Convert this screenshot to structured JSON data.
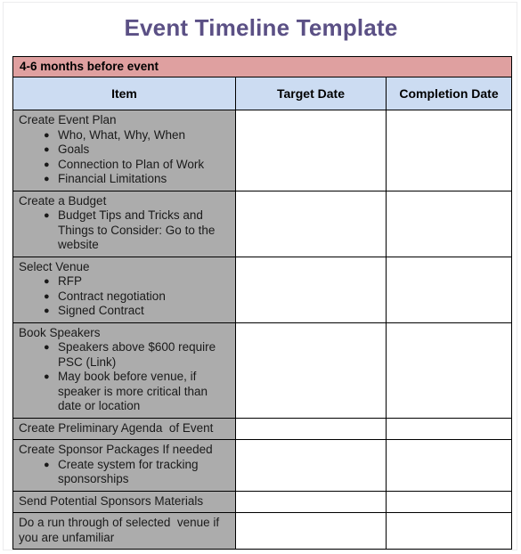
{
  "page": {
    "title": "Event Timeline Template",
    "title_color": "#5b5085",
    "band_color": "#dfa0a0",
    "header_color": "#ccdcf2",
    "item_cell_color": "#acacac"
  },
  "table": {
    "section_band": "4-6 months before event",
    "columns": [
      {
        "key": "item",
        "label": "Item"
      },
      {
        "key": "target_date",
        "label": "Target Date"
      },
      {
        "key": "completion_date",
        "label": "Completion Date"
      }
    ],
    "rows": [
      {
        "lead": "Create Event Plan",
        "bullets": [
          "Who, What, Why, When",
          "Goals",
          "Connection to Plan of Work",
          "Financial Limitations"
        ],
        "target_date": "",
        "completion_date": ""
      },
      {
        "lead": "Create a Budget",
        "bullets": [
          "Budget Tips and Tricks and Things to Consider: Go to the website"
        ],
        "target_date": "",
        "completion_date": ""
      },
      {
        "lead": "Select Venue",
        "bullets": [
          "RFP",
          "Contract negotiation",
          "Signed Contract"
        ],
        "target_date": "",
        "completion_date": ""
      },
      {
        "lead": "Book Speakers",
        "bullets": [
          "Speakers above $600 require PSC (Link)",
          "May book before venue, if speaker is more critical than date or location"
        ],
        "target_date": "",
        "completion_date": ""
      },
      {
        "lead": "Create Preliminary Agenda  of Event",
        "bullets": [],
        "target_date": "",
        "completion_date": ""
      },
      {
        "lead": "Create Sponsor Packages If needed",
        "bullets": [
          "Create system for tracking sponsorships"
        ],
        "target_date": "",
        "completion_date": ""
      },
      {
        "lead": "Send Potential Sponsors Materials",
        "bullets": [],
        "target_date": "",
        "completion_date": ""
      },
      {
        "lead": "Do a run through of selected  venue if you are unfamiliar",
        "bullets": [],
        "target_date": "",
        "completion_date": ""
      }
    ],
    "bullet_glyph": "●"
  }
}
